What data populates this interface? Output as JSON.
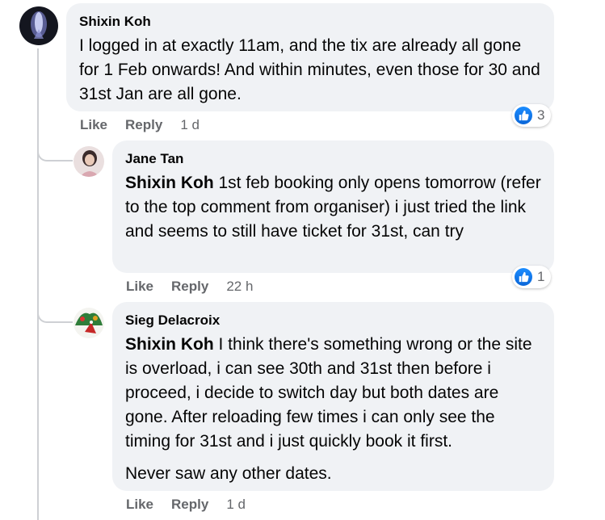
{
  "comments": [
    {
      "author": "Shixin Koh",
      "mention": "",
      "text": "I logged in at exactly 11am, and the tix are already all gone for 1 Feb onwards! And within minutes, even those for 30 and 31st Jan are all gone.",
      "extra": "",
      "like_label": "Like",
      "reply_label": "Reply",
      "time": "1 d",
      "reaction_count": "3"
    },
    {
      "author": "Jane Tan",
      "mention": "Shixin Koh",
      "text": " 1st feb booking only opens tomorrow (refer to the top comment from organiser) i just tried the link and seems to still have ticket for 31st, can try",
      "extra": "",
      "like_label": "Like",
      "reply_label": "Reply",
      "time": "22 h",
      "reaction_count": "1"
    },
    {
      "author": "Sieg Delacroix",
      "mention": "Shixin Koh",
      "text": " I think there's something wrong or the site is overload, i can see 30th and 31st then before i proceed, i decide to switch day but both dates are gone. After reloading few times i can only see the timing for 31st and i just quickly book it first.",
      "extra": "Never saw any other dates.",
      "like_label": "Like",
      "reply_label": "Reply",
      "time": "1 d"
    }
  ],
  "colors": {
    "bubble": "#f0f2f5",
    "meta_text": "#65676b",
    "like_blue": "#1877f2",
    "thread_line": "#ced0d4"
  }
}
